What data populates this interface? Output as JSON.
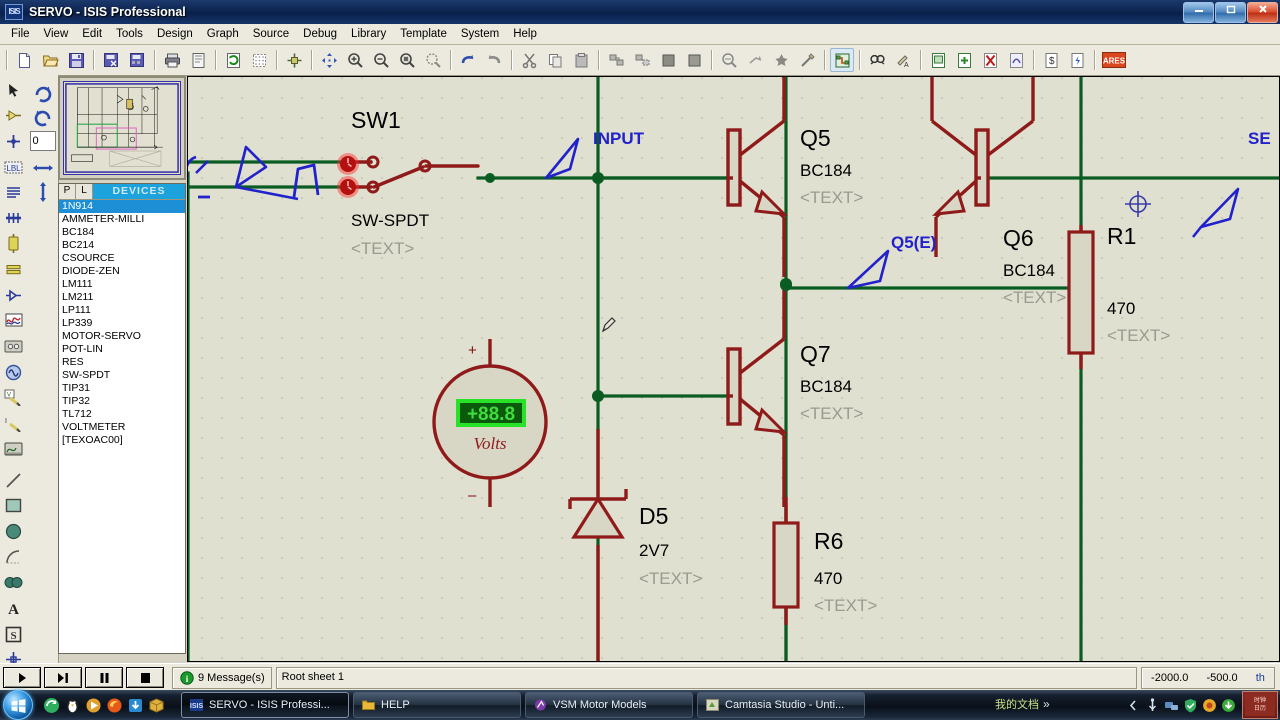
{
  "window": {
    "title": "SERVO - ISIS Professional",
    "app_icon": "isis-icon",
    "buttons": {
      "minimize": "—",
      "restore": "❐",
      "close": "✕"
    }
  },
  "menubar": {
    "items": [
      "File",
      "View",
      "Edit",
      "Tools",
      "Design",
      "Graph",
      "Source",
      "Debug",
      "Library",
      "Template",
      "System",
      "Help"
    ]
  },
  "toolbar": {
    "groups": [
      {
        "name": "file",
        "buttons": [
          {
            "icon": "new-document-icon",
            "label": "New Design"
          },
          {
            "icon": "open-folder-icon",
            "label": "Open Design"
          },
          {
            "icon": "save-icon",
            "label": "Save Design"
          },
          {
            "icon": "import-section-icon",
            "label": "Import Section"
          },
          {
            "icon": "export-section-icon",
            "label": "Export Section"
          },
          {
            "icon": "printer-icon",
            "label": "Print Design"
          },
          {
            "icon": "print-area-icon",
            "label": "Mark Output Area"
          }
        ]
      },
      {
        "name": "view",
        "buttons": [
          {
            "icon": "refresh-icon",
            "label": "Redraw Display"
          },
          {
            "icon": "grid-dots-icon",
            "label": "Toggle Grid"
          },
          {
            "icon": "origin-icon",
            "label": "Toggle False Origin"
          },
          {
            "icon": "pan-icon",
            "label": "Centre At Cursor"
          },
          {
            "icon": "zoom-in-icon",
            "label": "Zoom In"
          },
          {
            "icon": "zoom-out-icon",
            "label": "Zoom Out"
          },
          {
            "icon": "zoom-all-icon",
            "label": "Zoom To View Entire Sheet"
          },
          {
            "icon": "zoom-area-icon",
            "label": "Zoom To Area"
          }
        ]
      },
      {
        "name": "edit",
        "buttons": [
          {
            "icon": "undo-icon",
            "label": "Undo"
          },
          {
            "icon": "redo-icon",
            "label": "Redo"
          },
          {
            "icon": "cut-icon",
            "label": "Cut To Clipboard"
          },
          {
            "icon": "copy-icon",
            "label": "Copy To Clipboard"
          },
          {
            "icon": "paste-icon",
            "label": "Paste From Clipboard"
          }
        ]
      },
      {
        "name": "block",
        "buttons": [
          {
            "icon": "block-copy-icon",
            "label": "Copy Blocks"
          },
          {
            "icon": "block-move-icon",
            "label": "Move Blocks"
          },
          {
            "icon": "block-rotate-icon",
            "label": "Rotate Blocks"
          },
          {
            "icon": "block-delete-icon",
            "label": "Delete Blocks"
          },
          {
            "icon": "pick-device-icon",
            "label": "Pick Device/Symbol"
          },
          {
            "icon": "make-device-icon",
            "label": "Make Device"
          },
          {
            "icon": "package-tool-icon",
            "label": "Packaging Tool"
          },
          {
            "icon": "decompose-icon",
            "label": "Decompose"
          }
        ]
      },
      {
        "name": "tools2",
        "buttons": [
          {
            "icon": "wire-autorouter-icon",
            "label": "Toggle Wire Auto Router"
          },
          {
            "icon": "search-tag-icon",
            "label": "Search And Tag"
          },
          {
            "icon": "property-assign-icon",
            "label": "Property Assignment Tool"
          },
          {
            "icon": "new-sheet-icon",
            "label": "New Sheet"
          },
          {
            "icon": "add-sheet-icon",
            "label": "Add Sheet"
          },
          {
            "icon": "remove-sheet-icon",
            "label": "Remove Sheet"
          },
          {
            "icon": "exit-sheet-icon",
            "label": "Exit To Parent Sheet"
          },
          {
            "icon": "bill-of-materials-icon",
            "label": "Bill Of Materials"
          },
          {
            "icon": "erc-icon",
            "label": "Electrical Rules Check"
          },
          {
            "icon": "ares-icon",
            "label": "Netlist Transfer To ARES"
          }
        ]
      }
    ]
  },
  "left_tools": [
    {
      "icon": "selection-pointer-icon",
      "label": "Selection Mode"
    },
    {
      "icon": "component-icon",
      "label": "Component Mode"
    },
    {
      "icon": "junction-dot-icon",
      "label": "Junction Dot Mode"
    },
    {
      "icon": "wire-label-icon",
      "label": "Wire Label Mode"
    },
    {
      "icon": "text-script-icon",
      "label": "Text Script Mode"
    },
    {
      "icon": "bus-icon",
      "label": "Buses Mode"
    },
    {
      "icon": "subcircuit-icon",
      "label": "Subcircuit Mode"
    },
    {
      "icon": "terminal-icon",
      "label": "Terminals Mode"
    },
    {
      "icon": "device-pin-icon",
      "label": "Device Pins Mode"
    },
    {
      "icon": "graph-icon",
      "label": "Graph Mode"
    },
    {
      "icon": "tape-recorder-icon",
      "label": "Tape Recorder Mode"
    },
    {
      "icon": "generator-icon",
      "label": "Generator Mode"
    },
    {
      "icon": "voltage-probe-icon",
      "label": "Voltage Probe Mode"
    },
    {
      "icon": "current-probe-icon",
      "label": "Current Probe Mode"
    },
    {
      "icon": "virtual-instrument-icon",
      "label": "Virtual Instruments Mode"
    },
    {
      "icon": "line-icon",
      "label": "2D Graphics Line Mode"
    },
    {
      "icon": "box-icon",
      "label": "2D Graphics Box Mode"
    },
    {
      "icon": "circle-icon",
      "label": "2D Graphics Circle Mode"
    },
    {
      "icon": "arc-icon",
      "label": "2D Graphics Arc Mode"
    },
    {
      "icon": "path-icon",
      "label": "2D Graphics Closed Path Mode"
    },
    {
      "icon": "text-icon",
      "label": "2D Graphics Text Mode"
    },
    {
      "icon": "symbol-icon",
      "label": "2D Graphics Symbols Mode"
    },
    {
      "icon": "marker-icon",
      "label": "2D Graphics Markers Mode"
    }
  ],
  "orientation": {
    "rotate_cw": "rotate-clockwise-icon",
    "rotate_ccw": "rotate-counterclockwise-icon",
    "angle_value": "0",
    "mirror_x": "mirror-horizontal-icon",
    "mirror_y": "mirror-vertical-icon"
  },
  "devices": {
    "header": {
      "p": "P",
      "l": "L",
      "title": "DEVICES"
    },
    "selected": "1N914",
    "items": [
      "1N914",
      "AMMETER-MILLI",
      "BC184",
      "BC214",
      "CSOURCE",
      "DIODE-ZEN",
      "LM111",
      "LM211",
      "LP111",
      "LP339",
      "MOTOR-SERVO",
      "POT-LIN",
      "RES",
      "SW-SPDT",
      "TIP31",
      "TIP32",
      "TL712",
      "VOLTMETER",
      "[TEXOAC00]"
    ]
  },
  "schematic": {
    "components": [
      {
        "ref": "SW1",
        "value": "SW-SPDT",
        "text": "<TEXT>"
      },
      {
        "ref": "Q5",
        "value": "BC184",
        "text": "<TEXT>"
      },
      {
        "ref": "Q6",
        "value": "BC184",
        "text": "<TEXT>"
      },
      {
        "ref": "Q7",
        "value": "BC184",
        "text": "<TEXT>"
      },
      {
        "ref": "R1",
        "value": "470",
        "text": "<TEXT>"
      },
      {
        "ref": "R6",
        "value": "470",
        "text": "<TEXT>"
      },
      {
        "ref": "D5",
        "value": "2V7",
        "text": "<TEXT>"
      }
    ],
    "net_labels": [
      "INPUT",
      "Q5(E)",
      "SE"
    ],
    "voltmeter": {
      "display": "+88.8",
      "unit": "Volts",
      "plus": "+",
      "minus": "–"
    }
  },
  "statusbar": {
    "sim_buttons": [
      {
        "icon": "play-icon",
        "label": "Play"
      },
      {
        "icon": "step-icon",
        "label": "Step"
      },
      {
        "icon": "pause-icon",
        "label": "Pause"
      },
      {
        "icon": "stop-icon",
        "label": "Stop"
      }
    ],
    "messages": "9 Message(s)",
    "message_icon": "info-icon",
    "sheet": "Root sheet 1",
    "coord_x": "-2000.0",
    "coord_y": "-500.0",
    "coord_unit": "th"
  },
  "taskbar": {
    "start_label": "start-orb-icon",
    "quick_launch": [
      {
        "icon": "browser-icon"
      },
      {
        "icon": "qq-penguin-icon"
      },
      {
        "icon": "media-icon"
      },
      {
        "icon": "firefox-icon"
      },
      {
        "icon": "download-icon"
      },
      {
        "icon": "box-app-icon"
      }
    ],
    "tasks": [
      {
        "icon": "isis-icon",
        "label": "SERVO - ISIS Professi...",
        "active": true
      },
      {
        "icon": "folder-icon",
        "label": "HELP",
        "active": false
      },
      {
        "icon": "vsm-icon",
        "label": "VSM Motor Models",
        "active": false
      },
      {
        "icon": "camtasia-icon",
        "label": "Camtasia Studio - Unti...",
        "active": false
      }
    ],
    "language": "我的文档",
    "overflow": "»",
    "tray": [
      {
        "icon": "chevron-left-icon"
      },
      {
        "icon": "usb-icon"
      },
      {
        "icon": "network-icon"
      },
      {
        "icon": "shield-icon"
      },
      {
        "icon": "antivirus-icon"
      },
      {
        "icon": "update-icon"
      }
    ],
    "clock": "时钟"
  },
  "colors": {
    "wire_green": "#0a5c22",
    "component_red": "#8f1a1a",
    "canvas_bg": "#e0e0d0",
    "net_label_blue": "#2222cc",
    "accent_cyan": "#1ca3dd",
    "title_blue": "#0d2550"
  }
}
